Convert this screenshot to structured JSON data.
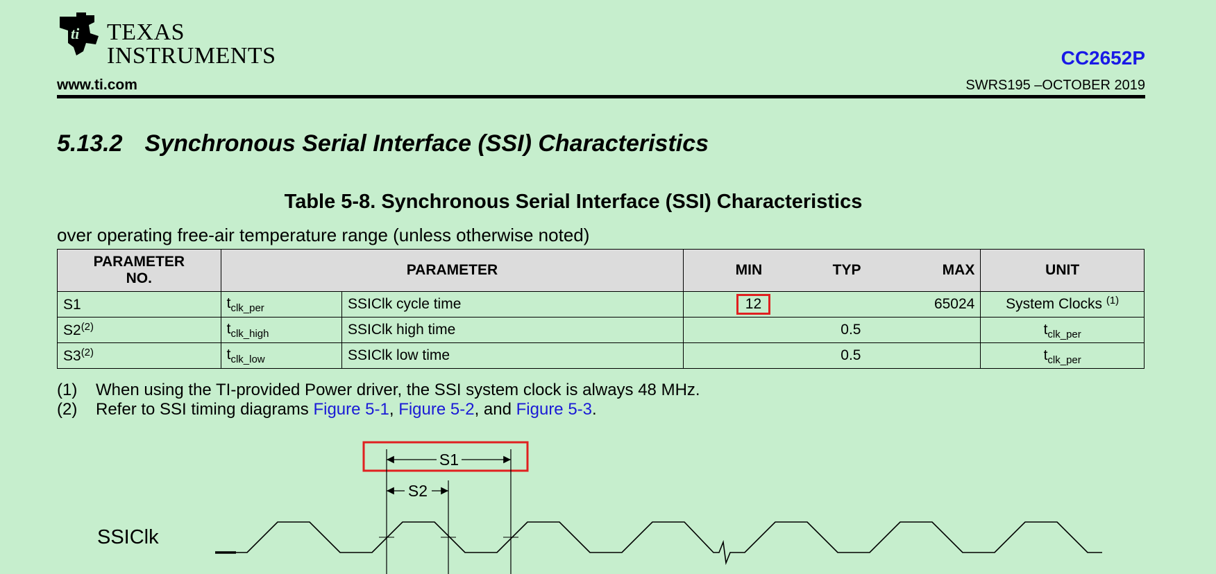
{
  "header": {
    "logo_line1": "TEXAS",
    "logo_line2": "INSTRUMENTS",
    "product": "CC2652P",
    "website": "www.ti.com",
    "doc_number": "SWRS195 –OCTOBER 2019"
  },
  "section": {
    "number": "5.13.2",
    "title": "Synchronous Serial Interface (SSI) Characteristics"
  },
  "table": {
    "title": "Table 5-8. Synchronous Serial Interface (SSI) Characteristics",
    "subtitle": "over operating free-air temperature range (unless otherwise noted)",
    "headers": {
      "param_no": "PARAMETER NO.",
      "parameter": "PARAMETER",
      "min": "MIN",
      "typ": "TYP",
      "max": "MAX",
      "unit": "UNIT"
    },
    "rows": [
      {
        "no": "S1",
        "no_note": "",
        "sym": "t",
        "sym_sub": "clk_per",
        "desc": "SSIClk cycle time",
        "min": "12",
        "typ": "",
        "max": "65024",
        "unit": "System Clocks",
        "unit_sub": "",
        "unit_note": "(1)"
      },
      {
        "no": "S2",
        "no_note": "(2)",
        "sym": "t",
        "sym_sub": "clk_high",
        "desc": "SSIClk high time",
        "min": "",
        "typ": "0.5",
        "max": "",
        "unit": "t",
        "unit_sub": "clk_per",
        "unit_note": ""
      },
      {
        "no": "S3",
        "no_note": "(2)",
        "sym": "t",
        "sym_sub": "clk_low",
        "desc": "SSIClk low time",
        "min": "",
        "typ": "0.5",
        "max": "",
        "unit": "t",
        "unit_sub": "clk_per",
        "unit_note": ""
      }
    ]
  },
  "footnotes": {
    "fn1_key": "(1)",
    "fn1_text": "When using the TI-provided Power driver, the SSI system clock is always 48 MHz.",
    "fn2_key": "(2)",
    "fn2_pre": "Refer to SSI timing diagrams ",
    "fig1": "Figure 5-1",
    "sep1": ", ",
    "fig2": "Figure 5-2",
    "sep2": ", and ",
    "fig3": "Figure 5-3",
    "end": "."
  },
  "diagram": {
    "signal_label": "SSIClk",
    "s1_label": "S1",
    "s2_label": "S2"
  },
  "colors": {
    "background": "#c6eecd",
    "highlight": "#e02020",
    "link": "#1a1ad6",
    "product": "#1919e6"
  }
}
